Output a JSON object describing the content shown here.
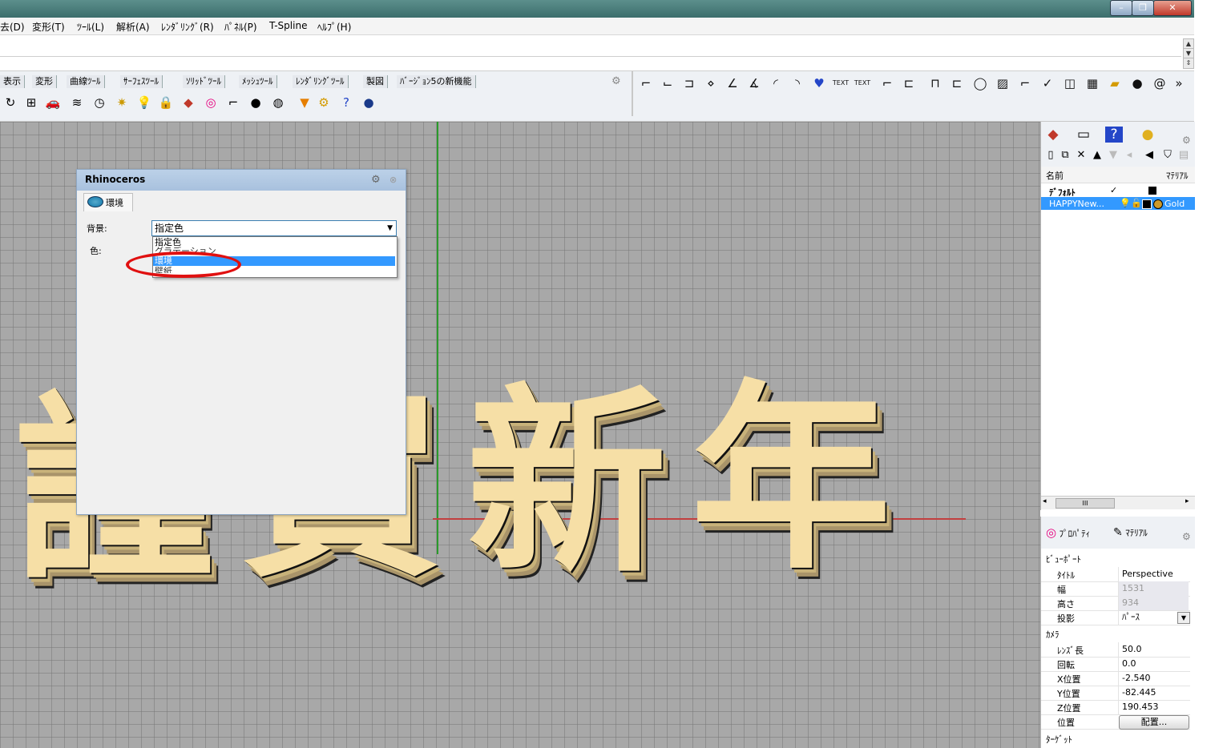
{
  "window": {
    "minimize": "–",
    "restore": "❐",
    "close": "✕"
  },
  "menu": [
    "去(D)",
    "変形(T)",
    "ﾂｰﾙ(L)",
    "解析(A)",
    "ﾚﾝﾀﾞﾘﾝｸﾞ(R)",
    "ﾊﾟﾈﾙ(P)",
    "T-Spline",
    "ﾍﾙﾌﾟ(H)"
  ],
  "toolbar_tabs": [
    "表示",
    "変形",
    "曲線ﾂｰﾙ",
    "ｻｰﾌｪｽﾂｰﾙ",
    "ｿﾘｯﾄﾞﾂｰﾙ",
    "ﾒｯｼｭﾂｰﾙ",
    "ﾚﾝﾀﾞﾘﾝｸﾞﾂｰﾙ",
    "製図",
    "ﾊﾞｰｼﾞｮﾝ5の新機能"
  ],
  "right_toolbar_text": {
    "text1": "TEXT",
    "text2": "TEXT",
    "more": "»"
  },
  "viewport": {
    "chars": [
      "謹",
      "賀",
      "新",
      "年"
    ]
  },
  "rhino_panel": {
    "title": "Rhinoceros",
    "tab": "環境",
    "background_label": "背景:",
    "color_label": "色:",
    "background_value": "指定色",
    "dropdown_options": [
      "指定色",
      "グラデーション",
      "環境",
      "壁紙"
    ],
    "selected_option": "環境"
  },
  "layer_panel": {
    "col_name": "名前",
    "col_material": "ﾏﾃﾘｱﾙ",
    "rows": [
      {
        "name": "ﾃﾞﾌｫﾙﾄ",
        "check": "✓"
      },
      {
        "name": "HAPPYNew...",
        "material": "Gold"
      }
    ],
    "scroll_thumb": "III"
  },
  "properties": {
    "tabs": [
      "ﾌﾟﾛﾊﾟﾃｨ",
      "ﾏﾃﾘｱﾙ"
    ],
    "viewport_section": "ﾋﾞｭｰﾎﾟｰﾄ",
    "title_label": "ﾀｲﾄﾙ",
    "title_value": "Perspective",
    "width_label": "幅",
    "width_value": "1531",
    "height_label": "高さ",
    "height_value": "934",
    "projection_label": "投影",
    "projection_value": "ﾊﾟｰｽ",
    "camera_section": "ｶﾒﾗ",
    "lens_label": "ﾚﾝｽﾞ長",
    "lens_value": "50.0",
    "rotation_label": "回転",
    "rotation_value": "0.0",
    "x_label": "X位置",
    "x_value": "-2.540",
    "y_label": "Y位置",
    "y_value": "-82.445",
    "z_label": "Z位置",
    "z_value": "190.453",
    "position_label": "位置",
    "place_button": "配置...",
    "target_section": "ﾀｰｹﾞｯﾄ"
  },
  "colors": {
    "selection": "#3399ff",
    "panel_header": "#bcd1e8",
    "highlight_circle": "#e01010",
    "text_fill": "#f6dfa6"
  }
}
